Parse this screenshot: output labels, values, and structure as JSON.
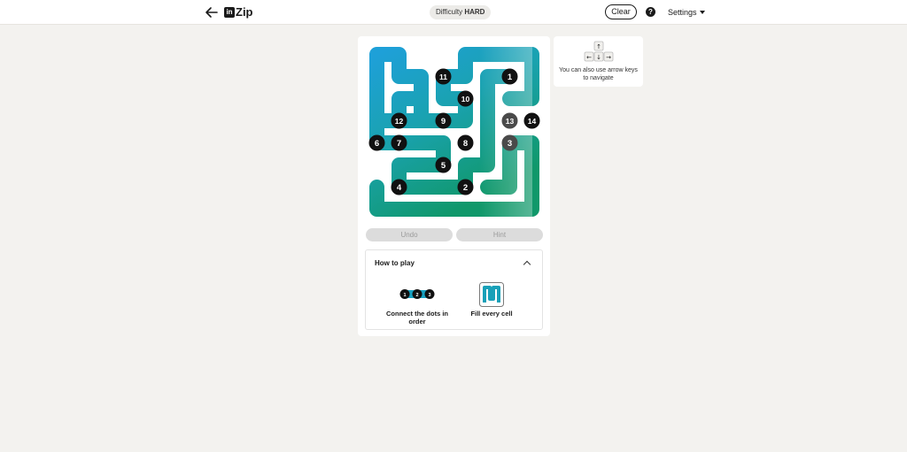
{
  "header": {
    "brand": "Zip",
    "logo": "in",
    "difficulty_label": "Difficulty",
    "difficulty_value": "HARD",
    "clear_label": "Clear",
    "help_label": "?",
    "settings_label": "Settings"
  },
  "board": {
    "dots": [
      "1",
      "2",
      "3",
      "4",
      "5",
      "6",
      "7",
      "8",
      "9",
      "10",
      "11",
      "12",
      "13",
      "14"
    ]
  },
  "controls": {
    "undo_label": "Undo",
    "hint_label": "Hint"
  },
  "how_to_play": {
    "title": "How to play",
    "step1_label": "Connect the dots in order",
    "step1_dots": [
      "1",
      "2",
      "3"
    ],
    "step2_label": "Fill every cell"
  },
  "keyboard_hint": {
    "text": "You can also use arrow keys to navigate",
    "keys": [
      "↑",
      "←",
      "↓",
      "→"
    ]
  },
  "colors": {
    "path_blue": "#1e9fd6",
    "path_green": "#12976a",
    "dot": "#111111",
    "dot_visited": "#4a4a4a"
  }
}
